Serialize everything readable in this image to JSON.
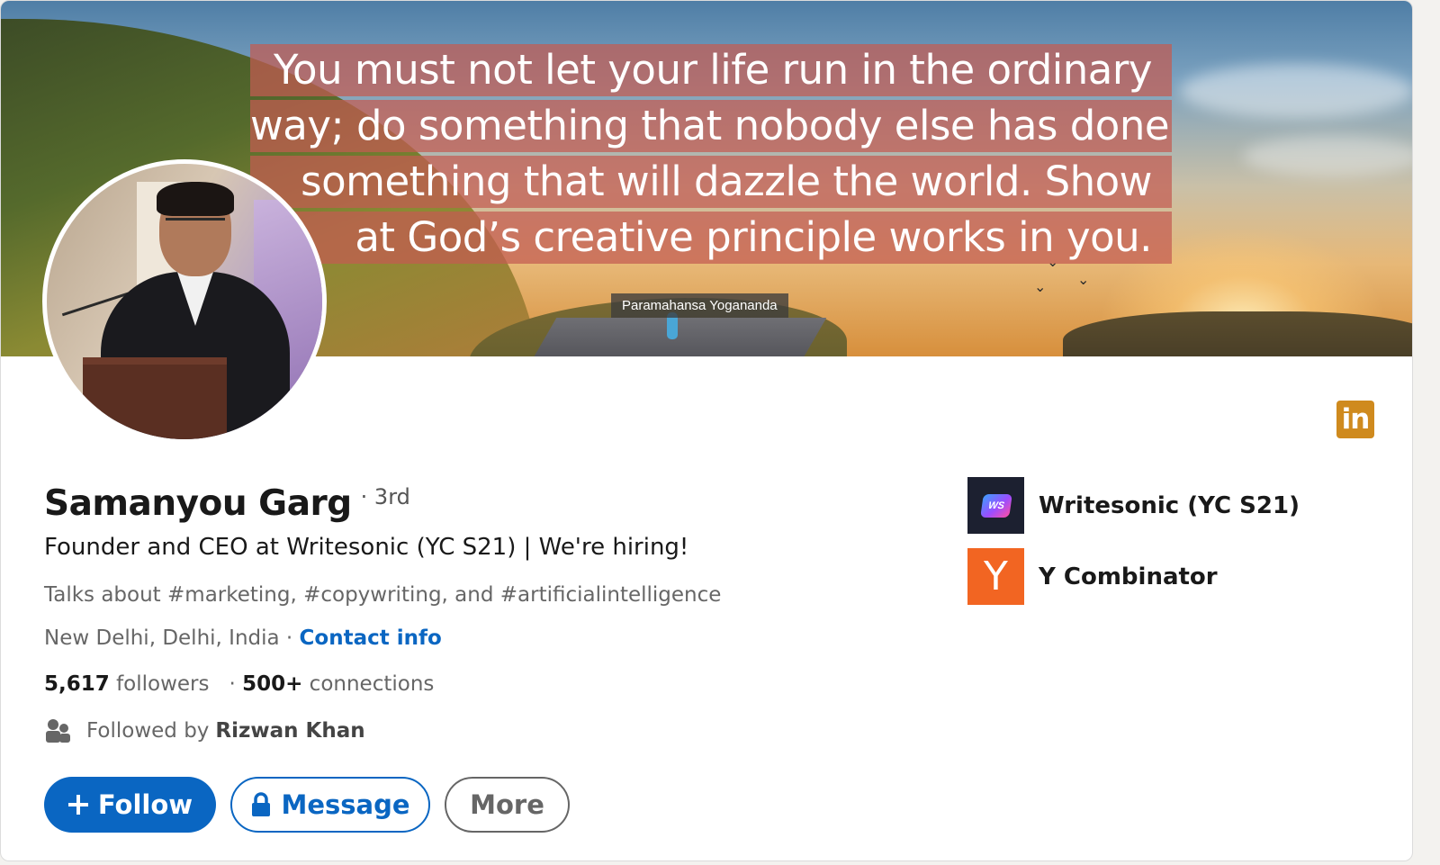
{
  "profile": {
    "name": "Samanyou Garg",
    "degree": "· 3rd",
    "headline": "Founder and CEO at Writesonic (YC S21) | We're hiring!",
    "talks_about": "Talks about #marketing, #copywriting, and #artificialintelligence",
    "location": "New Delhi, Delhi, India ·",
    "contact_info": "Contact info",
    "followers_count": "5,617",
    "followers_label": "followers",
    "separator": "·",
    "connections_count": "500+",
    "connections_label": "connections",
    "followed_by_label": "Followed by",
    "followed_by_name": "Rizwan Khan"
  },
  "banner": {
    "quote_lines": [
      "You must not let your life run in the ordinary",
      "way; do something that nobody else has done,",
      "something that will dazzle the world. Show",
      "at God’s creative principle works in you."
    ],
    "author": "Paramahansa Yogananda"
  },
  "actions": {
    "follow": "Follow",
    "message": "Message",
    "more": "More"
  },
  "companies": [
    {
      "name": "Writesonic (YC S21)",
      "logo_text": "WS",
      "logo_color": "#1c2030"
    },
    {
      "name": "Y Combinator",
      "logo_text": "Y",
      "logo_color": "#f26522"
    }
  ],
  "brand_badge": "in",
  "colors": {
    "primary": "#0a66c2",
    "badge": "#cf8a1e",
    "yc_orange": "#f26522"
  }
}
